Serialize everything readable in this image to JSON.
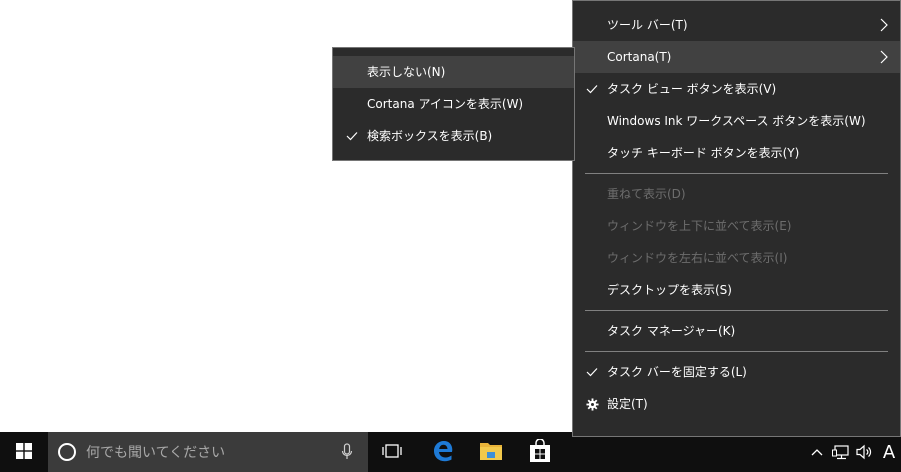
{
  "taskbar": {
    "search_placeholder": "何でも聞いてください",
    "ime_indicator": "A",
    "icons": [
      "windows-logo-icon",
      "cortana-icon",
      "microphone-icon",
      "task-view-icon",
      "edge-icon",
      "file-explorer-icon",
      "store-icon",
      "chevron-up-icon",
      "network-icon",
      "volume-icon"
    ]
  },
  "main_menu": {
    "toolbar": "ツール バー(T)",
    "cortana": "Cortana(T)",
    "task_view": "タスク ビュー ボタンを表示(V)",
    "windows_ink": "Windows Ink ワークスペース ボタンを表示(W)",
    "touch_keyboard": "タッチ キーボード ボタンを表示(Y)",
    "cascade": "重ねて表示(D)",
    "stack": "ウィンドウを上下に並べて表示(E)",
    "side_by_side": "ウィンドウを左右に並べて表示(I)",
    "show_desktop": "デスクトップを表示(S)",
    "task_manager": "タスク マネージャー(K)",
    "lock_taskbar": "タスク バーを固定する(L)",
    "settings": "設定(T)"
  },
  "cortana_submenu": {
    "hidden": "表示しない(N)",
    "show_icon": "Cortana アイコンを表示(W)",
    "show_search_box": "検索ボックスを表示(B)"
  },
  "colors": {
    "menu_bg": "#2b2b2b",
    "menu_hover": "#414141",
    "menu_disabled": "#6d6d6d",
    "taskbar_bg": "#0f0f0f",
    "search_bg": "#3b3b3b",
    "edge_blue": "#1e7ad6",
    "folder_yellow": "#f2c94c"
  }
}
